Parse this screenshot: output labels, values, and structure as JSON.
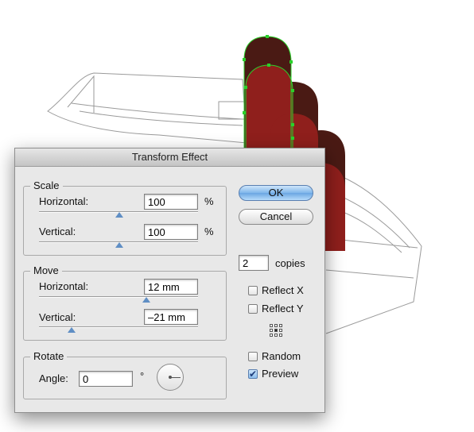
{
  "dialog": {
    "title": "Transform Effect"
  },
  "scale": {
    "title": "Scale",
    "horizontal_label": "Horizontal:",
    "horizontal_value": "100",
    "horizontal_unit": "%",
    "vertical_label": "Vertical:",
    "vertical_value": "100",
    "vertical_unit": "%"
  },
  "move": {
    "title": "Move",
    "horizontal_label": "Horizontal:",
    "horizontal_value": "12 mm",
    "vertical_label": "Vertical:",
    "vertical_value": "–21 mm"
  },
  "rotate": {
    "title": "Rotate",
    "angle_label": "Angle:",
    "angle_value": "0",
    "angle_unit": "°"
  },
  "buttons": {
    "ok_label": "OK",
    "cancel_label": "Cancel"
  },
  "copies": {
    "value": "2",
    "label": "copies"
  },
  "options": {
    "reflect_x": "Reflect X",
    "reflect_x_checked": false,
    "reflect_y": "Reflect Y",
    "reflect_y_checked": false,
    "random": "Random",
    "random_checked": false,
    "preview": "Preview",
    "preview_checked": true
  },
  "icons": {
    "reference_point": "reference-point-icon",
    "rotate_dial": "rotate-dial-icon",
    "checkmark": "✔"
  },
  "colors": {
    "dark_shape": "#4a1a14",
    "red_shape": "#8f1f1c",
    "selection": "#2ad12a",
    "accent": "#6aa6e2"
  }
}
